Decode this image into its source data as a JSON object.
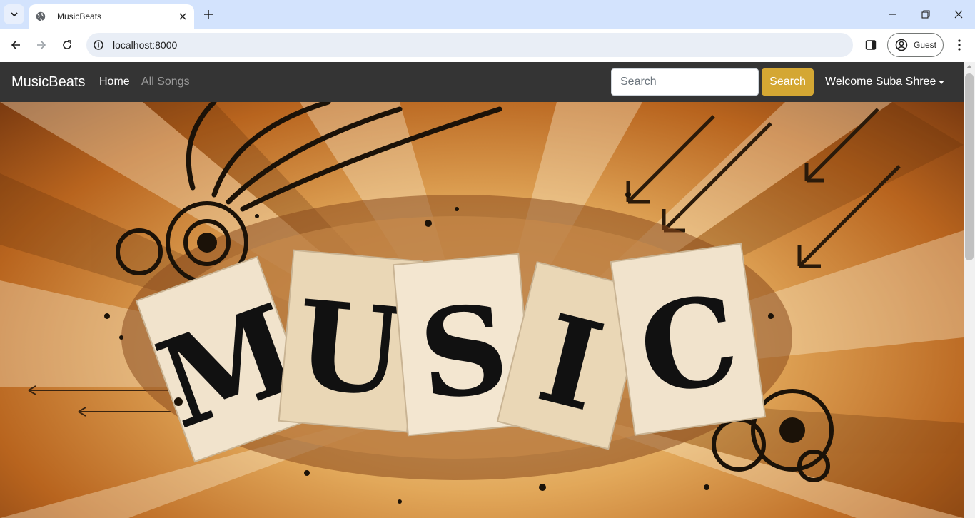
{
  "browser": {
    "tab_title": "MusicBeats",
    "url": "localhost:8000",
    "profile_label": "Guest"
  },
  "navbar": {
    "brand": "MusicBeats",
    "links": [
      "Home",
      "All Songs"
    ],
    "search_placeholder": "Search",
    "search_button": "Search",
    "user_menu": "Welcome Suba Shree"
  },
  "hero": {
    "letters": [
      "M",
      "U",
      "S",
      "I",
      "C"
    ]
  },
  "colors": {
    "navbar_bg": "#343434",
    "search_button_bg": "#d4a733",
    "tabstrip_bg": "#d3e3fd"
  }
}
